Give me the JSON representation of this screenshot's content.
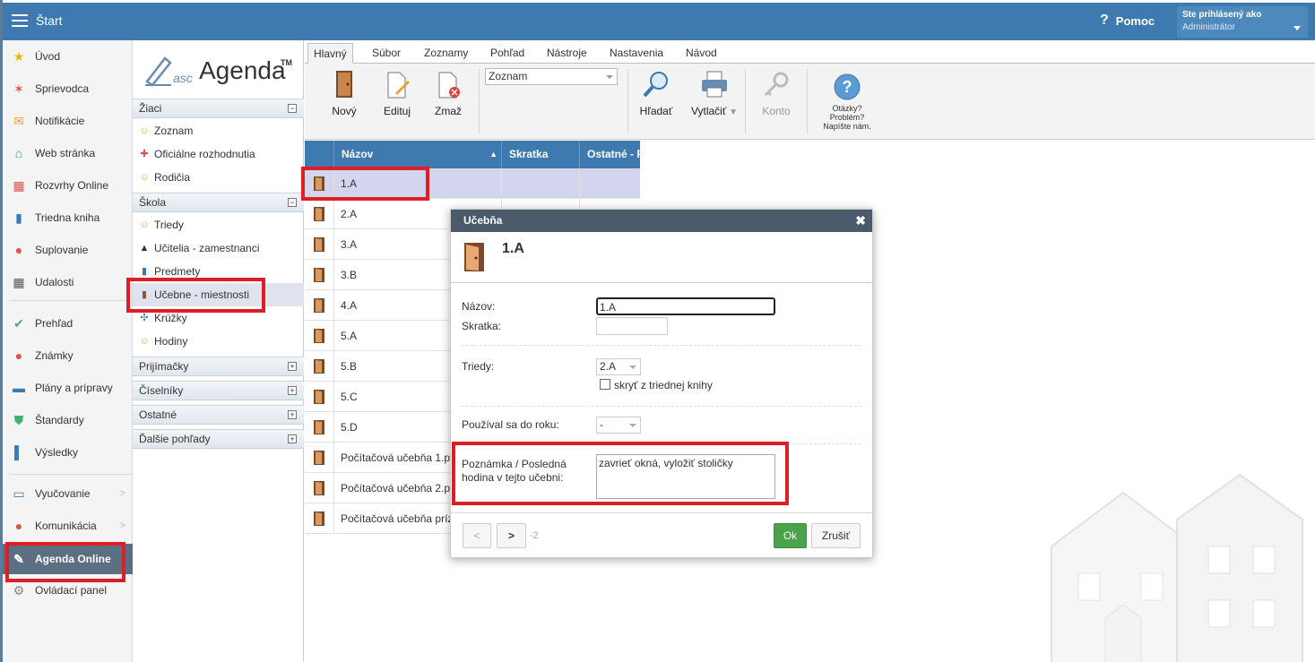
{
  "topbar": {
    "title": "Štart",
    "help_label": "Pomoc",
    "user_label": "Ste prihlásený ako",
    "user_name": "Administrátor"
  },
  "leftnav": {
    "items": [
      {
        "label": "Úvod"
      },
      {
        "label": "Sprievodca"
      },
      {
        "label": "Notifikácie"
      },
      {
        "label": "Web stránka"
      },
      {
        "label": "Rozvrhy Online"
      },
      {
        "label": "Triedna kniha"
      },
      {
        "label": "Suplovanie"
      },
      {
        "label": "Udalosti"
      },
      {
        "label": "Prehľad"
      },
      {
        "label": "Známky"
      },
      {
        "label": "Plány a prípravy"
      },
      {
        "label": "Štandardy"
      },
      {
        "label": "Výsledky"
      },
      {
        "label": "Vyučovanie"
      },
      {
        "label": "Komunikácia"
      },
      {
        "label": "Agenda Online"
      },
      {
        "label": "Ovládací panel"
      }
    ]
  },
  "logo": {
    "asc": "asc",
    "agenda": "Agenda",
    "tm": "TM"
  },
  "sections": {
    "ziaci": {
      "title": "Žiaci",
      "items": [
        "Zoznam",
        "Oficiálne rozhodnutia",
        "Rodičia"
      ]
    },
    "skola": {
      "title": "Škola",
      "items": [
        "Triedy",
        "Učitelia - zamestnanci",
        "Predmety",
        "Učebne - miestnosti",
        "Krúžky",
        "Hodiny"
      ]
    },
    "collapsed": [
      "Prijímačky",
      "Číselníky",
      "Ostatné",
      "Ďalšie pohľady"
    ]
  },
  "tabs": [
    "Hlavný",
    "Súbor",
    "Zoznamy",
    "Pohľad",
    "Nástroje",
    "Nastavenia",
    "Návod"
  ],
  "ribbon": {
    "new_label": "Nový",
    "edit_label": "Edituj",
    "delete_label": "Zmaž",
    "view_select": "Zoznam",
    "search_label": "Hľadať",
    "print_label": "Vytlačiť",
    "account_label": "Konto",
    "help_line1": "Otázky?",
    "help_line2": "Problém?",
    "help_line3": "Napíšte nám."
  },
  "grid": {
    "headers": [
      "Názov",
      "Skratka",
      "Ostatné - P"
    ],
    "rows": [
      "1.A",
      "2.A",
      "3.A",
      "3.B",
      "4.A",
      "5.A",
      "5.B",
      "5.C",
      "5.D",
      "Počítačová učebňa 1.p",
      "Počítačová učebňa 2.p",
      "Počítačová učebňa príz"
    ]
  },
  "dialog": {
    "title": "Učebňa",
    "close": "✖",
    "heading": "1.A",
    "name_label": "Názov:",
    "name_value": "1.A",
    "short_label": "Skratka:",
    "short_value": "",
    "classes_label": "Triedy:",
    "classes_value": "2.A",
    "hide_label": "skryť z triednej knihy",
    "used_label": "Používal sa do roku:",
    "used_value": "-",
    "note_label": "Poznámka / Posledná hodina v tejto učebni:",
    "note_value": "zavrieť okná, vyložiť stoličky",
    "prev": "<",
    "next": ">",
    "counter": "-2",
    "ok": "Ok",
    "cancel": "Zrušiť"
  },
  "colors": {
    "header_blue": "#3e7aaf",
    "highlight_red": "#e01c24",
    "ok_green": "#4aa24a",
    "selected_row": "#d3d4ee"
  }
}
